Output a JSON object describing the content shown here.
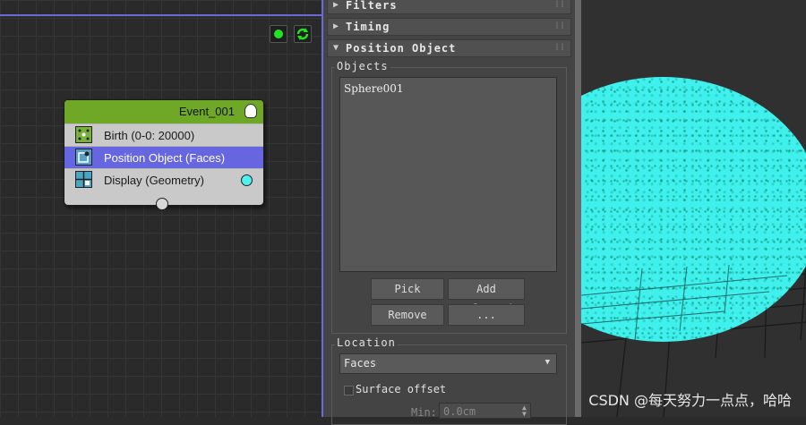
{
  "graph": {
    "event": {
      "title": "Event_001",
      "operators": [
        {
          "label": "Birth (0-0: 20000)",
          "icon": "birth-icon"
        },
        {
          "label": "Position Object (Faces)",
          "icon": "position-object-icon",
          "selected": true
        },
        {
          "label": "Display (Geometry)",
          "icon": "display-icon"
        }
      ]
    },
    "toolbar": {
      "run_icon": "green-dot-icon",
      "refresh_icon": "refresh-icon"
    }
  },
  "panel": {
    "rollouts": [
      "Filters",
      "Timing",
      "Position Object"
    ],
    "objects": {
      "label": "Objects",
      "items": [
        "Sphere001"
      ],
      "pick_label": "Pick",
      "add_selected_label": "Add selected",
      "remove_label": "Remove",
      "more_label": "..."
    },
    "location": {
      "label": "Location",
      "value": "Faces",
      "surface_offset_label": "Surface offset",
      "surface_offset_checked": false,
      "min_label": "Min:",
      "min_value": "0.0cm"
    }
  },
  "viewport": {
    "sphere_color": "#3ff0ec"
  },
  "watermark": "CSDN @每天努力一点点，哈哈",
  "colors": {
    "event_header": "#6fa827",
    "selection": "#6666e0",
    "graph_border": "#6a6ad8"
  }
}
